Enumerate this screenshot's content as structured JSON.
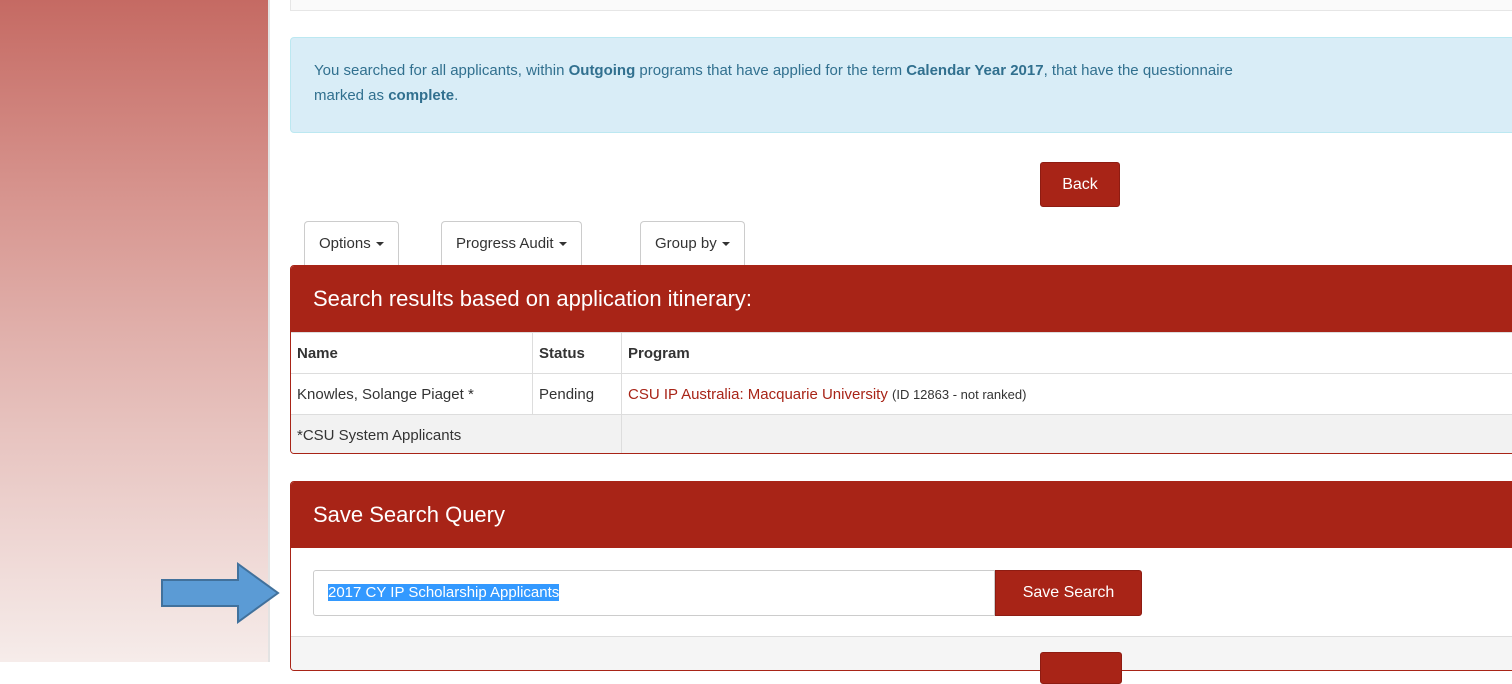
{
  "info": {
    "p1": "You searched for all applicants, within ",
    "b1": "Outgoing",
    "p2": " programs that have applied for the term ",
    "b2": "Calendar Year 2017",
    "p3": ", that have the questionnaire",
    "p4": "marked as ",
    "b3": "complete",
    "p5": "."
  },
  "back_label": "Back",
  "tabs": [
    {
      "label": "Options"
    },
    {
      "label": "Progress Audit"
    },
    {
      "label": "Group by"
    }
  ],
  "results": {
    "title": "Search results based on application itinerary:",
    "columns": [
      "Name",
      "Status",
      "Program"
    ],
    "rows": [
      {
        "name": "Knowles, Solange Piaget *",
        "status": "Pending",
        "program": "CSU IP Australia: Macquarie University",
        "program_note": "(ID 12863 - not ranked)"
      }
    ],
    "footnote": "*CSU System Applicants"
  },
  "save_query": {
    "title": "Save Search Query",
    "input_value": "2017 CY IP Scholarship Applicants",
    "button_label": "Save Search"
  },
  "colors": {
    "brand_red": "#a82417",
    "info_bg": "#d9edf7",
    "info_text": "#31708f",
    "arrow": "#5b9bd5"
  },
  "icons": {
    "caret": "caret-down-icon",
    "arrow": "arrow-right-icon"
  }
}
